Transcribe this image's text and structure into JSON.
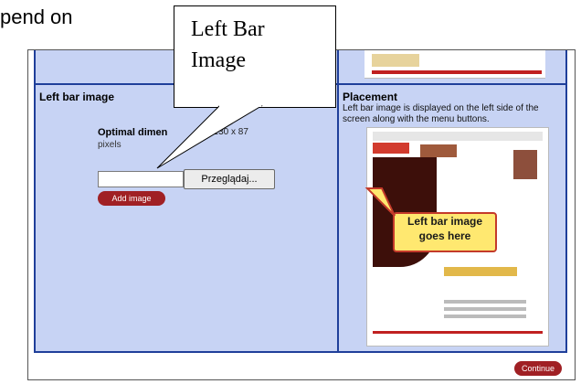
{
  "intro_text": "pend on",
  "left_panel": {
    "title": "Left bar image",
    "optimal_label": "Optimal dimen",
    "optimal_tail": "s: 130 x 87",
    "pixels": "pixels",
    "browse_button": "Przeglądaj...",
    "add_button": "Add image"
  },
  "right_panel": {
    "title": "Placement",
    "description": "Left bar image is displayed on the left side of the screen along with the menu buttons.",
    "yellow_callout": "Left bar image goes here"
  },
  "callout": {
    "line1": "Left Bar",
    "line2": "Image"
  },
  "footer": {
    "continue_button": "Continue"
  },
  "colors": {
    "panel_bg": "#c7d3f4",
    "border": "#1f3f9a",
    "button_red": "#a02024",
    "callout_yellow": "#ffe870"
  }
}
